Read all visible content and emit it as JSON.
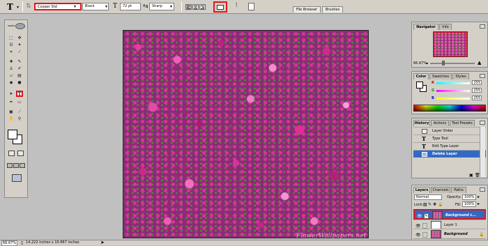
{
  "options_bar": {
    "tool_glyph": "T",
    "font_family": "Cooper Std",
    "font_style": "Black",
    "font_size": "72 pt",
    "antialias": "Sharp",
    "text_color": "#ffffff",
    "tabs": [
      "File Browser",
      "Brushes"
    ]
  },
  "toolbox": {
    "selected_tool": "type-tool",
    "foreground_color": "#ffffff",
    "background_color": "#ffffff"
  },
  "canvas": {
    "watermark": "FlowerWallpapers.net"
  },
  "navigator": {
    "tabs": [
      "Navigator",
      "Info"
    ],
    "zoom": "66.67%"
  },
  "color": {
    "tabs": [
      "Color",
      "Swatches",
      "Styles"
    ],
    "channels": [
      {
        "label": "R",
        "value": "255",
        "color": "#ff0000"
      },
      {
        "label": "G",
        "value": "255",
        "color": "#00aa00"
      },
      {
        "label": "B",
        "value": "255",
        "color": "#0000ff"
      }
    ]
  },
  "history": {
    "tabs": [
      "History",
      "Actions",
      "Tool Presets"
    ],
    "items": [
      {
        "label": "Layer Order",
        "icon": "layer-icon",
        "selected": false
      },
      {
        "label": "Type Tool",
        "icon": "type-icon",
        "selected": false
      },
      {
        "label": "Edit Type Layer",
        "icon": "type-icon",
        "selected": false
      },
      {
        "label": "Delete Layer",
        "icon": "layer-icon",
        "selected": true
      }
    ]
  },
  "layers": {
    "tabs": [
      "Layers",
      "Channels",
      "Paths"
    ],
    "blend_mode": "Normal",
    "opacity_label": "Opacity:",
    "opacity": "100%",
    "lock_label": "Lock:",
    "fill_label": "Fill:",
    "fill": "100%",
    "items": [
      {
        "name": "Background c...",
        "thumb": "flower",
        "selected": true
      },
      {
        "name": "Layer 1",
        "thumb": "white",
        "selected": false
      },
      {
        "name": "Background",
        "thumb": "flower",
        "selected": false,
        "locked": true
      }
    ]
  },
  "status_bar": {
    "zoom": "66.67%",
    "doc_size": "14.222 inches x 10.667 inches"
  }
}
